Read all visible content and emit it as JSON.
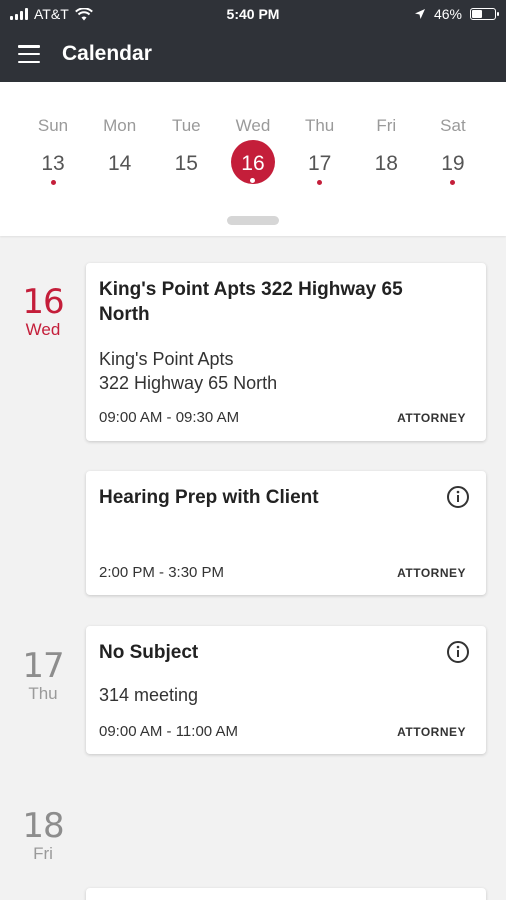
{
  "status_bar": {
    "carrier": "AT&T",
    "time": "5:40 PM",
    "battery": "46%",
    "battery_level": 0.46
  },
  "header": {
    "title": "Calendar"
  },
  "week": [
    {
      "name": "Sun",
      "num": "13",
      "has_event": true,
      "selected": false
    },
    {
      "name": "Mon",
      "num": "14",
      "has_event": false,
      "selected": false
    },
    {
      "name": "Tue",
      "num": "15",
      "has_event": false,
      "selected": false
    },
    {
      "name": "Wed",
      "num": "16",
      "has_event": true,
      "selected": true
    },
    {
      "name": "Thu",
      "num": "17",
      "has_event": true,
      "selected": false
    },
    {
      "name": "Fri",
      "num": "18",
      "has_event": false,
      "selected": false
    },
    {
      "name": "Sat",
      "num": "19",
      "has_event": true,
      "selected": false
    }
  ],
  "agenda": {
    "dates": [
      {
        "num": "16",
        "weekday": "Wed",
        "active": true
      },
      {
        "num": "17",
        "weekday": "Thu",
        "active": false
      },
      {
        "num": "18",
        "weekday": "Fri",
        "active": false
      }
    ],
    "events": [
      {
        "title": "King's Point Apts 322 Highway 65 North",
        "location_line1": "King's Point Apts",
        "location_line2": "322 Highway 65 North",
        "time": "09:00 AM - 09:30 AM",
        "category": "ATTORNEY"
      },
      {
        "title": "Hearing Prep with Client",
        "time": "2:00 PM - 3:30 PM",
        "category": "ATTORNEY"
      },
      {
        "title": "No Subject",
        "location_line1": "314 meeting",
        "time": "09:00 AM - 11:00 AM",
        "category": "ATTORNEY"
      }
    ]
  },
  "colors": {
    "accent": "#c41e3a",
    "header_bg": "#2f3238"
  }
}
